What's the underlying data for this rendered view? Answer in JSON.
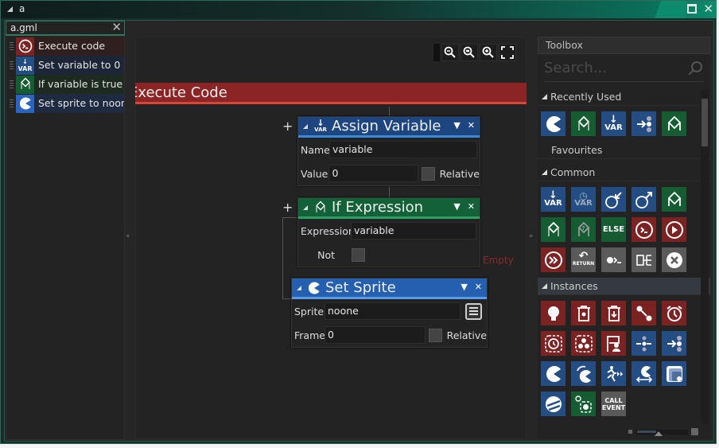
{
  "window": {
    "title": "a"
  },
  "file_tab": {
    "name": "a.gml"
  },
  "events": [
    {
      "label": "Execute code",
      "icon": "execute-code-icon",
      "color": "#7b2222",
      "row_bg": "#2f1f1f"
    },
    {
      "label": "Set variable to 0",
      "icon": "var-icon",
      "color": "#244d84",
      "row_bg": "#1d2636"
    },
    {
      "label": "If variable is true",
      "icon": "if-variable-icon",
      "color": "#155c33",
      "row_bg": "#1d2a20"
    },
    {
      "label": "Set sprite to noone",
      "icon": "sprite-icon",
      "color": "#2a64c0",
      "row_bg": "#1d2a40"
    }
  ],
  "canvas": {
    "exec_title": "Execute Code",
    "empty_label": "Empty",
    "blocks": {
      "assign": {
        "title": "Assign Variable",
        "name_label": "Name",
        "name_value": "variable",
        "value_label": "Value",
        "value_value": "0",
        "relative_label": "Relative"
      },
      "if": {
        "title": "If Expression",
        "expr_label": "Expression",
        "expr_value": "variable",
        "not_label": "Not"
      },
      "sprite": {
        "title": "Set Sprite",
        "sprite_label": "Sprite",
        "sprite_value": "noone",
        "frame_label": "Frame",
        "frame_value": "0",
        "relative_label": "Relative"
      }
    }
  },
  "toolbox": {
    "title": "Toolbox",
    "search_placeholder": "Search...",
    "sections": {
      "recent": "Recently Used",
      "favourites": "Favourites",
      "common": "Common",
      "instances": "Instances"
    },
    "recent_icons": [
      "sprite-icon",
      "if-variable-icon",
      "var-icon",
      "move-icon",
      "if-icon"
    ],
    "common_icons": [
      "var-icon",
      "var-time-icon",
      "get-global-icon",
      "set-global-icon",
      "if-icon",
      "if-variable-icon",
      "if-question-icon",
      "else-icon",
      "execute-code-icon",
      "play-icon",
      "continue-icon",
      "return-icon",
      "script-icon",
      "switch-icon",
      "exit-icon"
    ],
    "instance_icons": [
      "lightbulb-icon",
      "destroy-icon",
      "destroy-down-icon",
      "path-icon",
      "alarm-icon",
      "alarm-dashed-icon",
      "group-icon",
      "flag-person-icon",
      "gather-icon",
      "move-icon",
      "sprite-icon",
      "rotate-sprite-icon",
      "run-icon",
      "sprite-flip-icon",
      "image-scale-icon",
      "sprite-partial-icon",
      "select-icon",
      "call-event-icon"
    ],
    "labels": {
      "else": "ELSE",
      "var": "VAR",
      "return": "RETURN",
      "call": "CALL",
      "event": "EVENT"
    }
  }
}
